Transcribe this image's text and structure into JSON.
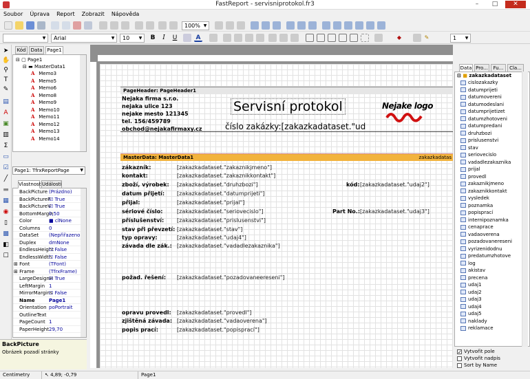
{
  "window": {
    "title": "FastReport - servisniprotokol.fr3",
    "min": "–",
    "max": "□",
    "close": "✕"
  },
  "menu": [
    "Soubor",
    "Úprava",
    "Report",
    "Zobrazit",
    "Nápověda"
  ],
  "toolbar": {
    "zoom": "100%",
    "font_name": "Arial",
    "font_size": "10",
    "line_width": "1"
  },
  "tabs": {
    "left": [
      "Kód",
      "Data",
      "Page1"
    ],
    "props": [
      "Vlastnosti",
      "Události"
    ],
    "right": [
      "Data",
      "Pro...",
      "Fu...",
      "Cla..."
    ]
  },
  "tree": {
    "page": "Page1",
    "masterdata": "MasterData1",
    "memos": [
      "Memo3",
      "Memo5",
      "Memo6",
      "Memo8",
      "Memo9",
      "Memo10",
      "Memo11",
      "Memo12",
      "Memo13",
      "Memo14"
    ]
  },
  "object_selector": "Page1: TfrxReportPage",
  "properties": [
    {
      "name": "BackPicture",
      "value": "(Prázdno)"
    },
    {
      "name": "BackPictureP",
      "value": "True"
    },
    {
      "name": "BackPictureV",
      "value": "True"
    },
    {
      "name": "BottomMargin",
      "value": "0,50"
    },
    {
      "name": "Color",
      "value": "clNone"
    },
    {
      "name": "Columns",
      "value": "0"
    },
    {
      "name": "DataSet",
      "value": "(Nepřiřazeno)"
    },
    {
      "name": "Duplex",
      "value": "dmNone"
    },
    {
      "name": "EndlessHeight",
      "value": "False"
    },
    {
      "name": "EndlessWidth",
      "value": "False"
    },
    {
      "name": "Font",
      "value": "(TFont)"
    },
    {
      "name": "Frame",
      "value": "(TfrxFrame)"
    },
    {
      "name": "LargeDesignH",
      "value": "True"
    },
    {
      "name": "LeftMargin",
      "value": "1"
    },
    {
      "name": "MirrorMargins",
      "value": "False"
    },
    {
      "name": "Name",
      "value": "Page1"
    },
    {
      "name": "Orientation",
      "value": "poPortrait"
    },
    {
      "name": "OutlineText",
      "value": ""
    },
    {
      "name": "PageCount",
      "value": "1"
    },
    {
      "name": "PaperHeight",
      "value": "29,70"
    }
  ],
  "hint": {
    "title": "BackPicture",
    "text": "Obrázek pozadí stránky"
  },
  "report": {
    "page_header_label": "PageHeader: PageHeader1",
    "company": [
      "Nejaka firma s.r.o.",
      "nejaka ulice 123",
      "nejake mesto 121345",
      "tel. 156/459789",
      "obchod@nejakafirmaxy.cz"
    ],
    "title": "Servisní protokol",
    "logo_text": "Nejake logo",
    "cislo_label": "číslo zakázky:",
    "cislo_field": "[zakazkadataset.\"ud",
    "masterdata_label": "MasterData: MasterData1",
    "masterdata_ds": "zakazkadatas",
    "rows": [
      {
        "label": "zákazník:",
        "field": "[zakazkadataset.\"zakaznikjmeno\"]"
      },
      {
        "label": "kontakt:",
        "field": "[zakazkadataset.\"zakaznikkontakt\"]"
      },
      {
        "label": "zboží, výrobek:",
        "field": "[zakazkadataset.\"druhzbozi\"]"
      },
      {
        "label": "datum přijetí:",
        "field": "[zakazkadataset.\"datumprijeti\"]"
      },
      {
        "label": "přijal:",
        "field": "[zakazkadataset.\"prijal\"]"
      },
      {
        "label": "sériové číslo:",
        "field": "[zakazkadataset.\"seriovecislo\"]"
      },
      {
        "label": "příslušenství:",
        "field": "[zakazkadataset.\"prislusenstvi\"]"
      },
      {
        "label": "stav při převzetí:",
        "field": "[zakazkadataset.\"stav\"]"
      },
      {
        "label": "typ opravy:",
        "field": "[zakazkadataset.\"udaj4\"]"
      },
      {
        "label": "závada dle zák.:",
        "field": "[zakazkadataset.\"vadadlezakaznika\"]"
      }
    ],
    "kod_label": "kód:",
    "kod_field": "[zakazkadataset.\"udaj2\"]",
    "partno_label": "Part No.:",
    "partno_field": "[zakazkadataset.\"udaj3\"]",
    "pozad_label": "požad. řešení:",
    "pozad_field": "[zakazkadataset.\"pozadovaneereseni\"]",
    "bottom_rows": [
      {
        "label": "opravu provedl:",
        "field": "[zakazkadataset.\"provedl\"]"
      },
      {
        "label": "zjištěná závada:",
        "field": "[zakazkadataset.\"vadaoverena\"]"
      },
      {
        "label": "popis prací:",
        "field": "[zakazkadataset.\"popisprací\"]"
      }
    ]
  },
  "dataset": {
    "name": "zakazkadataset",
    "fields": [
      "cislozakazky",
      "datumprijeti",
      "datumovereni",
      "datumodeslani",
      "datumprijetizet",
      "datumzhotoveni",
      "datumpredani",
      "druhzbozi",
      "prislusenstvi",
      "stav",
      "seriovecislo",
      "vadadlezakaznika",
      "prijal",
      "provedl",
      "zakaznikjmeno",
      "zakaznikkontakt",
      "vysledek",
      "poznamka",
      "popisprací",
      "internipoznamka",
      "cenaprace",
      "vadaoverena",
      "pozadovaneresenі",
      "vyrizenidodnu",
      "predatumzhotove",
      "log",
      "akistav",
      "precena",
      "udaj1",
      "udaj2",
      "udaj3",
      "udaj4",
      "udaj5",
      "naklady",
      "reklamace"
    ]
  },
  "options": {
    "create_field": "Vytvořit pole",
    "create_header": "Vytvořit nadpis",
    "sort_by_name": "Sort by Name"
  },
  "status": {
    "units": "Centimetry",
    "coords": "4,89; -0,79",
    "page": "Page1"
  }
}
